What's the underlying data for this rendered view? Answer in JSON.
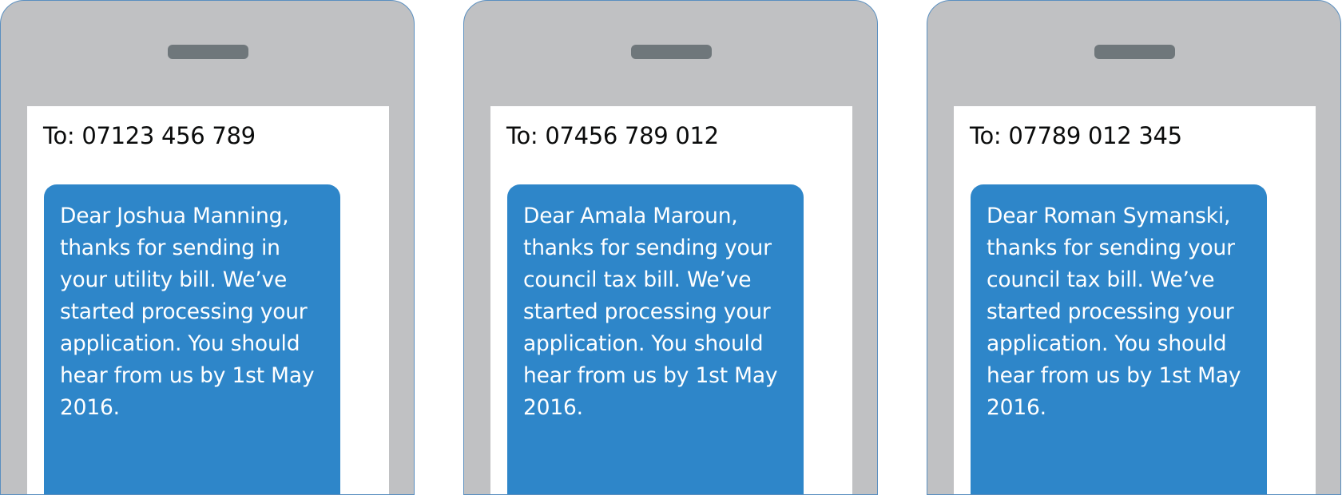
{
  "phones": [
    {
      "to": "To: 07123 456 789",
      "message": "Dear Joshua Manning, thanks for sending in your utility bill. We’ve started processing your application. You should hear from us by 1st May 2016."
    },
    {
      "to": "To: 07456 789 012",
      "message": "Dear Amala Maroun, thanks for sending your council tax bill. We’ve started processing your application. You should hear from us by 1st May 2016."
    },
    {
      "to": "To: 07789 012 345",
      "message": "Dear Roman Symanski, thanks for sending your council tax bill. We’ve started processing your application. You should hear from us by 1st May 2016."
    }
  ],
  "colors": {
    "phone_body": "#c0c1c3",
    "speaker": "#6f777b",
    "screen": "#ffffff",
    "bubble": "#2e86c9",
    "text_dark": "#0b0c0c"
  }
}
